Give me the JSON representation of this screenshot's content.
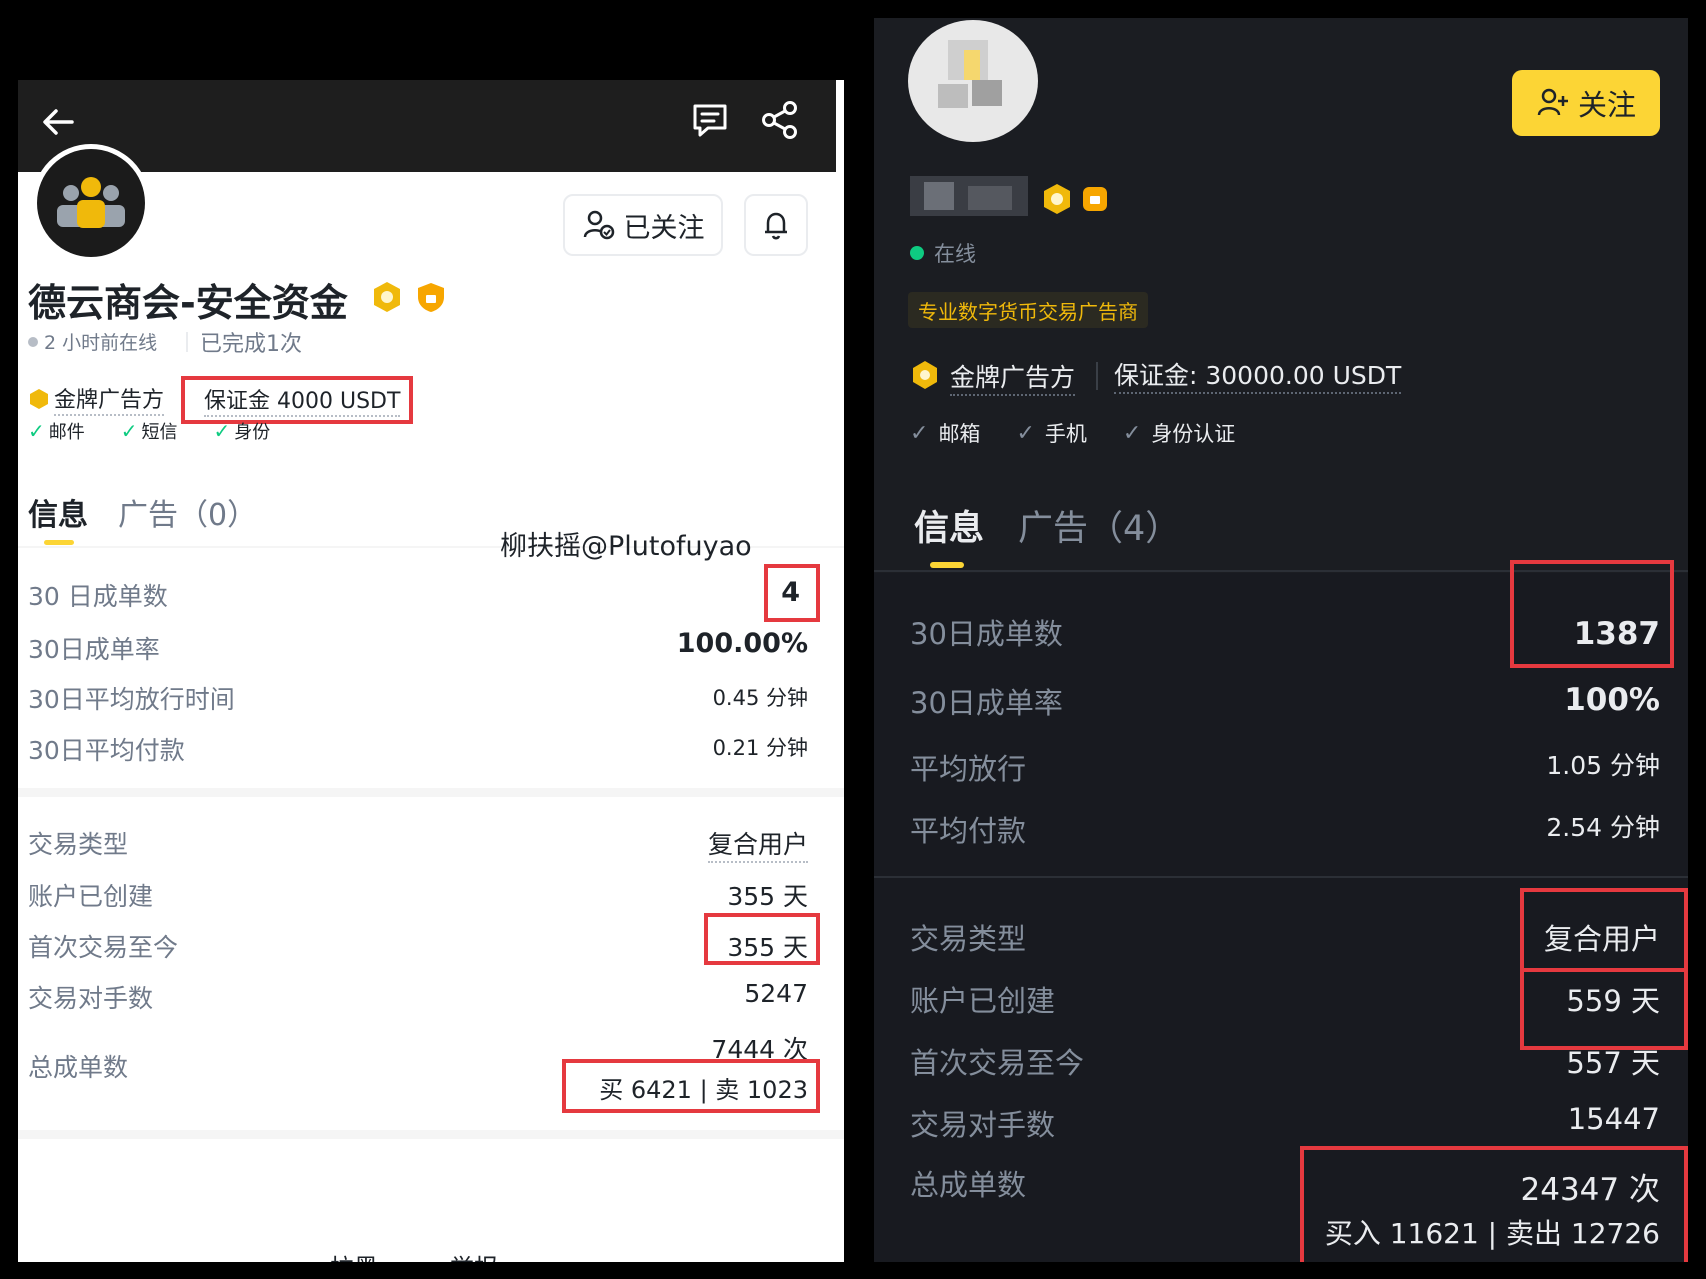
{
  "watermark": "柳扶摇@Plutofuyao",
  "colors": {
    "accent_yellow": "#fcd535",
    "highlight_red": "#e5393f",
    "online_green": "#0ecb81",
    "dark_bg": "#181a20",
    "light_bg": "#ffffff"
  },
  "left": {
    "header_icons": [
      "back-arrow-icon",
      "chat-icon",
      "share-icon"
    ],
    "follow_button": "已关注",
    "merchant_name": "德云商会-安全资金",
    "online_status": "2 小时前在线",
    "completed": "已完成1次",
    "badge": "金牌广告方",
    "deposit": "保证金 4000 USDT",
    "verifications": [
      "邮件",
      "短信",
      "身份"
    ],
    "tabs": {
      "info": "信息",
      "ads": "广告（0）"
    },
    "stats": [
      {
        "label": "30 日成单数",
        "value": "4"
      },
      {
        "label": "30日成单率",
        "value": "100.00%"
      },
      {
        "label": "30日平均放行时间",
        "value": "0.45 分钟"
      },
      {
        "label": "30日平均付款",
        "value": "0.21 分钟"
      }
    ],
    "details": [
      {
        "label": "交易类型",
        "value": "复合用户"
      },
      {
        "label": "账户已创建",
        "value": "355 天"
      },
      {
        "label": "首次交易至今",
        "value": "355 天"
      },
      {
        "label": "交易对手数",
        "value": "5247"
      }
    ],
    "total_label": "总成单数",
    "total_value": "7444 次",
    "buy_sell": "买 6421 | 卖 1023",
    "footer_partial": [
      "拉黑",
      "举报"
    ]
  },
  "right": {
    "follow_button": "关注",
    "online": "在线",
    "tag": "专业数字货币交易广告商",
    "badge": "金牌广告方",
    "deposit": "保证金: 30000.00 USDT",
    "verifications": [
      "邮箱",
      "手机",
      "身份认证"
    ],
    "tabs": {
      "info": "信息",
      "ads": "广告（4）"
    },
    "stats": [
      {
        "label": "30日成单数",
        "value": "1387"
      },
      {
        "label": "30日成单率",
        "value": "100%"
      },
      {
        "label": "平均放行",
        "value": "1.05 分钟"
      },
      {
        "label": "平均付款",
        "value": "2.54 分钟"
      }
    ],
    "details": [
      {
        "label": "交易类型",
        "value": "复合用户"
      },
      {
        "label": "账户已创建",
        "value": "559 天"
      },
      {
        "label": "首次交易至今",
        "value": "557 天"
      },
      {
        "label": "交易对手数",
        "value": "15447"
      }
    ],
    "total_label": "总成单数",
    "total_value": "24347 次",
    "buy_sell": "买入 11621 | 卖出 12726"
  }
}
